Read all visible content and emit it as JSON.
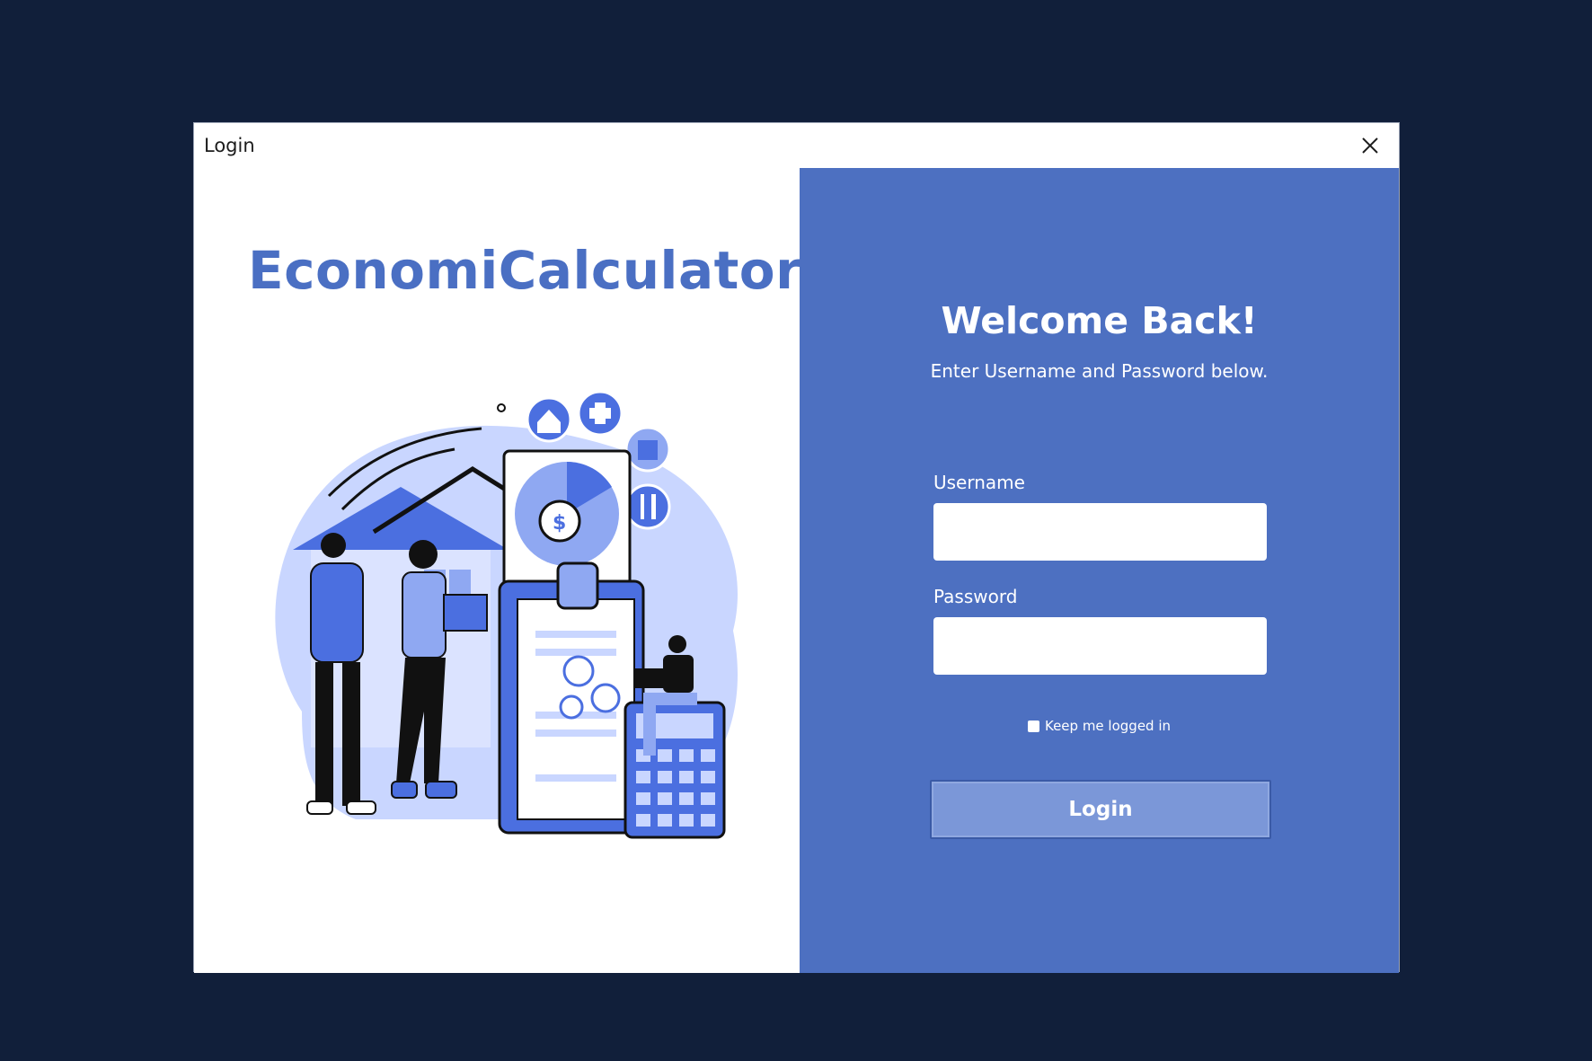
{
  "window": {
    "title": "Login"
  },
  "left": {
    "app_title": "EconomiCalculator"
  },
  "right": {
    "heading": "Welcome Back!",
    "subheading": "Enter Username and Password below.",
    "username_label": "Username",
    "username_value": "",
    "password_label": "Password",
    "password_value": "",
    "remember_label": "Keep me logged in",
    "remember_checked": false,
    "login_label": "Login"
  },
  "colors": {
    "background": "#111f3a",
    "panel": "#4d70c1",
    "button": "#7b97d8",
    "brand": "#4a6fc3"
  },
  "icons": [
    "close-icon",
    "house-icon",
    "plus-icon",
    "clothes-icon",
    "fork-knife-icon",
    "dollar-icon"
  ]
}
